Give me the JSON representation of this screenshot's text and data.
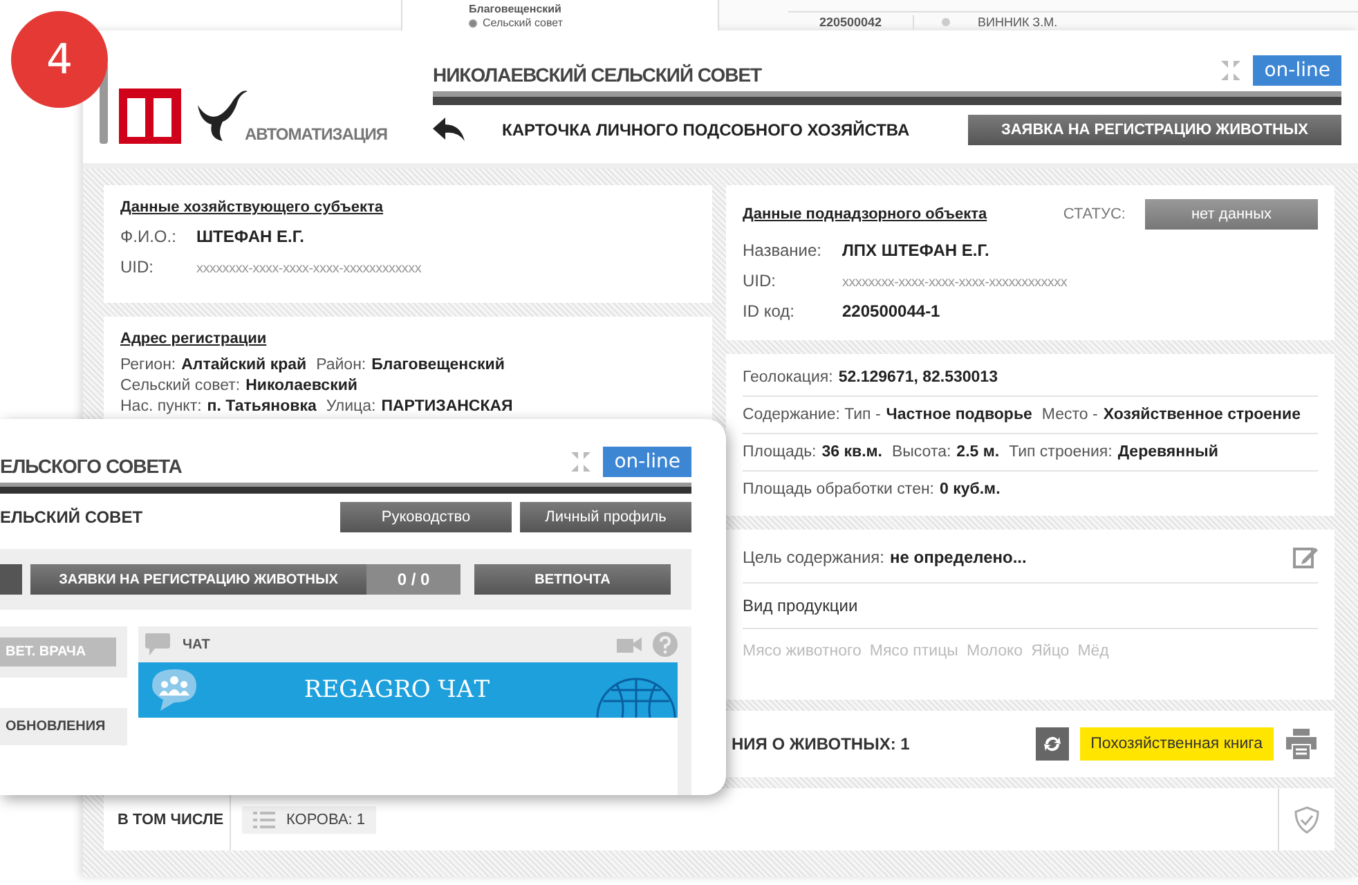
{
  "background_window": {
    "district": "Благовещенский",
    "filter_option": {
      "label": "Сельский совет",
      "selected": true
    },
    "row": {
      "id": "220500042",
      "name": "ВИННИК З.М."
    }
  },
  "badge": "4",
  "logo": {
    "caption": "АВТОМАТИЗАЦИЯ"
  },
  "header": {
    "title": "НИКОЛАЕВСКИЙ СЕЛЬСКИЙ СОВЕТ",
    "status": "on-line"
  },
  "subheader": {
    "title": "КАРТОЧКА ЛИЧНОГО ПОДСОБНОГО ХОЗЯЙСТВА",
    "action": "ЗАЯВКА НА РЕГИСТРАЦИЮ ЖИВОТНЫХ"
  },
  "subject": {
    "heading": "Данные хозяйствующего субъекта",
    "fields": [
      {
        "label": "Ф.И.О.:",
        "value": "ШТЕФАН Е.Г.",
        "kind": "bold"
      },
      {
        "label": "UID:",
        "value": "xxxxxxxx-xxxx-xxxx-xxxx-xxxxxxxxxxxx",
        "kind": "muted"
      }
    ]
  },
  "address": {
    "heading": "Адрес регистрации",
    "lines": [
      {
        "items": [
          {
            "label": "Регион:",
            "value": "Алтайский край"
          },
          {
            "label": "Район:",
            "value": "Благовещенский"
          }
        ]
      },
      {
        "items": [
          {
            "label": "Сельский совет:",
            "value": "Николаевский"
          }
        ]
      },
      {
        "items": [
          {
            "label": "Нас. пункт:",
            "value": "п. Татьяновка"
          },
          {
            "label": "Улица:",
            "value": "ПАРТИЗАНСКАЯ"
          }
        ]
      }
    ]
  },
  "object": {
    "heading": "Данные поднадзорного объекта",
    "status_label": "СТАТУС:",
    "status": "нет данных",
    "fields": [
      {
        "label": "Название:",
        "value": "ЛПХ ШТЕФАН Е.Г.",
        "kind": "bold"
      },
      {
        "label": "UID:",
        "value": "xxxxxxxx-xxxx-xxxx-xxxx-xxxxxxxxxxxx",
        "kind": "muted"
      },
      {
        "label": "ID код:",
        "value": "220500044-1",
        "kind": "bold"
      }
    ]
  },
  "details": {
    "rows": [
      {
        "items": [
          {
            "label": "Геолокация:",
            "value": "52.129671, 82.530013"
          }
        ]
      },
      {
        "items": [
          {
            "label": "Содержание: Тип -",
            "value": "Частное подворье"
          },
          {
            "label": "Место -",
            "value": "Хозяйственное строение"
          }
        ]
      },
      {
        "items": [
          {
            "label": "Площадь:",
            "value": "36 кв.м."
          },
          {
            "label": "Высота:",
            "value": "2.5 м."
          },
          {
            "label": "Тип строения:",
            "value": "Деревянный"
          }
        ]
      },
      {
        "items": [
          {
            "label": "Площадь обработки стен:",
            "value": "0 куб.м."
          }
        ]
      }
    ]
  },
  "purpose": {
    "label": "Цель содержания:",
    "value": "не определено...",
    "products_heading": "Вид продукции",
    "products": [
      {
        "label": "Мясо животного",
        "selected": false
      },
      {
        "label": "Мясо птицы",
        "selected": false
      },
      {
        "label": "Молоко",
        "selected": false
      },
      {
        "label": "Яйцо",
        "selected": false
      },
      {
        "label": "Мёд",
        "selected": false
      }
    ]
  },
  "animals": {
    "title": "НИЯ О ЖИВОТНЫХ: 1",
    "book_button": "Похозяйственная книга",
    "included_label": "В ТОМ ЧИСЛЕ",
    "items": [
      "КОРОВА: 1"
    ]
  },
  "overlay_window": {
    "title": "ЕЛЬСКОГО СОВЕТА",
    "status": "on-line",
    "subtitle": "ЕЛЬСКИЙ СОВЕТ",
    "buttons": [
      "Руководство",
      "Личный профиль"
    ],
    "tabs": [
      {
        "label": "ЗАЯВКИ НА РЕГИСТРАЦИЮ ЖИВОТНЫХ",
        "counter": "0 / 0"
      },
      {
        "label": "ВЕТПОЧТА"
      }
    ],
    "side_items": [
      "ВЕТ. ВРАЧА",
      "ОБНОВЛЕНИЯ"
    ],
    "chat": {
      "title": "ЧАТ",
      "banner": "REGAGRO ЧАТ"
    }
  }
}
